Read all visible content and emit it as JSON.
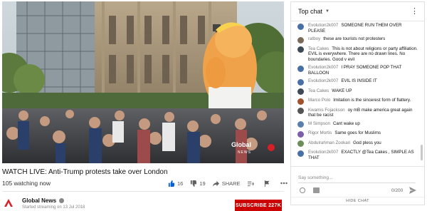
{
  "video": {
    "watermark_brand": "Global",
    "watermark_sub": "NEWS"
  },
  "title": "WATCH LIVE: Anti-Trump protests take over London",
  "views": "105 watching now",
  "actions": {
    "likes": "16",
    "dislikes": "19",
    "share": "SHARE"
  },
  "channel": {
    "name": "Global News",
    "subtitle": "Started streaming on 13 Jul 2018",
    "subscribe": "SUBSCRIBE  227K"
  },
  "chat": {
    "header": "Top chat",
    "messages": [
      {
        "author": "Evolution2k007",
        "text": "SOMEONE RUN THEM OVER PLEASE",
        "avatar": "#4a6fa5"
      },
      {
        "author": "ratboy",
        "text": "these are tourists not protesters",
        "avatar": "#7a6a5a"
      },
      {
        "author": "Tea Cakes",
        "text": "This is not about religions or party affiliation. EVIL is everywhere. There are no drawn lines. No boundaries. Good v evil",
        "avatar": "#3d4a55"
      },
      {
        "author": "Evolution2k007",
        "text": "I PRAY SOMEONE POP THAT BALLOON",
        "avatar": "#4a6fa5"
      },
      {
        "author": "Evolution2k007",
        "text": "EVIL IS INSIDE IT",
        "avatar": "#4a6fa5"
      },
      {
        "author": "Tea Cakes",
        "text": "WAKE UP",
        "avatar": "#3d4a55"
      },
      {
        "author": "Marco Polo",
        "text": "Imitation is the sincerest form of flattery.",
        "avatar": "#a0522d"
      },
      {
        "author": "Kwamis Fojackson",
        "text": "oy mB make america great again that be racist",
        "avatar": "#555555"
      },
      {
        "author": "M Simpson",
        "text": "Cant wake up",
        "avatar": "#5b7fa8"
      },
      {
        "author": "Rigor Mortis",
        "text": "Same goes for Muslims",
        "avatar": "#7b5fa8"
      },
      {
        "author": "Abdulrahman Zookari",
        "text": "God pless you",
        "avatar": "#6b8e5a"
      },
      {
        "author": "Evolution2k007",
        "text": "EXACTLY @Tea Cakes , SIMPLE AS THAT",
        "avatar": "#4a6fa5"
      }
    ],
    "input_placeholder": "Say something...",
    "counter": "0/200",
    "hide": "HIDE CHAT"
  }
}
